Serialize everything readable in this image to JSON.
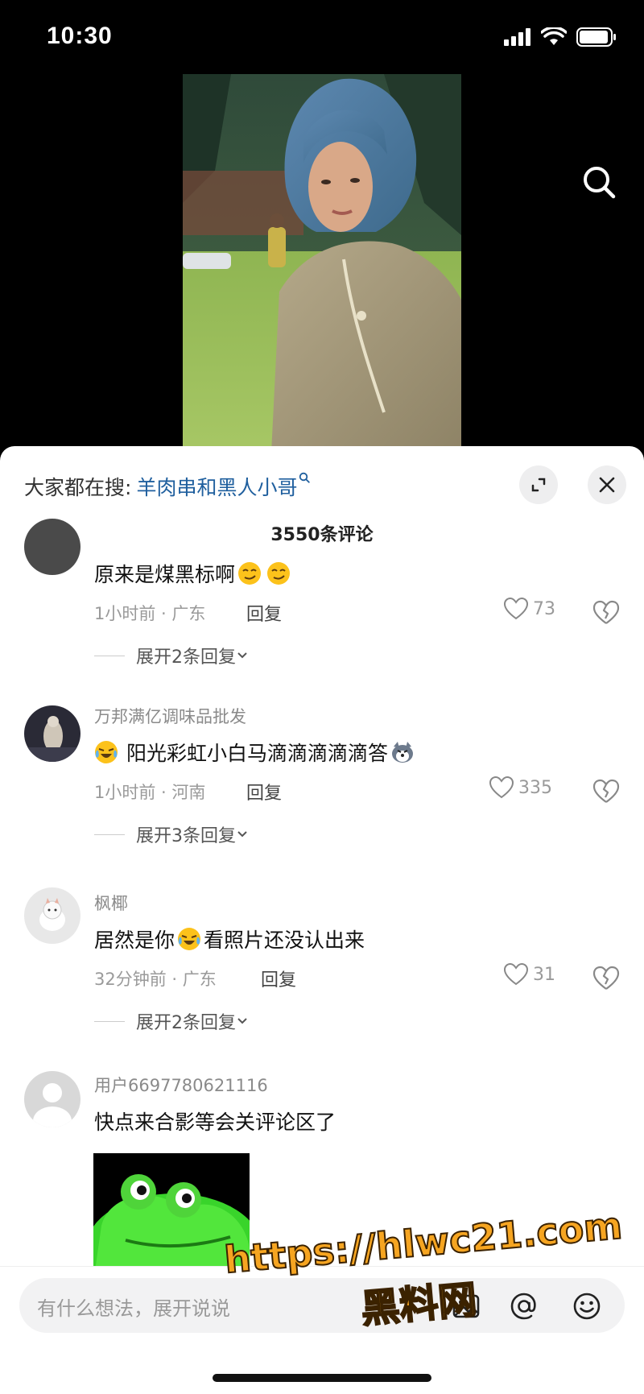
{
  "status_bar": {
    "time": "10:30"
  },
  "trending": {
    "prefix": "大家都在搜:",
    "term": "羊肉串和黑人小哥"
  },
  "comment_count": "3550条评论",
  "comments": [
    {
      "author": "",
      "text_parts": [
        "原来是煤黑标啊"
      ],
      "emojis": [
        "smirk-emoji",
        "smirk-emoji"
      ],
      "time_location": "1小时前 · 广东",
      "reply_label": "回复",
      "likes": "73",
      "expand_label": "展开2条回复"
    },
    {
      "author": "万邦满亿调味品批发",
      "text_parts": [
        "阳光彩虹小白马滴滴滴滴滴答"
      ],
      "emojis": [
        "laugh-cry-emoji",
        "husky-emoji"
      ],
      "time_location": "1小时前 · 河南",
      "reply_label": "回复",
      "likes": "335",
      "expand_label": "展开3条回复"
    },
    {
      "author": "枫椰",
      "text_parts": [
        "居然是你",
        "看照片还没认出来"
      ],
      "emojis": [
        "laugh-cry-emoji"
      ],
      "time_location": "32分钟前 · 广东",
      "reply_label": "回复",
      "likes": "31",
      "expand_label": "展开2条回复"
    },
    {
      "author": "用户6697780621116",
      "text_parts": [
        "快点来合影等会关评论区了"
      ],
      "emojis": [],
      "sticker": "frog-sticker"
    }
  ],
  "input": {
    "placeholder": "有什么想法，展开说说"
  },
  "watermark": {
    "url": "https://hlwc21.com",
    "name": "黑料网"
  },
  "colors": {
    "link_blue": "#1f5f9e",
    "watermark_orange": "#f6a521",
    "frog_green": "#39d42b"
  }
}
